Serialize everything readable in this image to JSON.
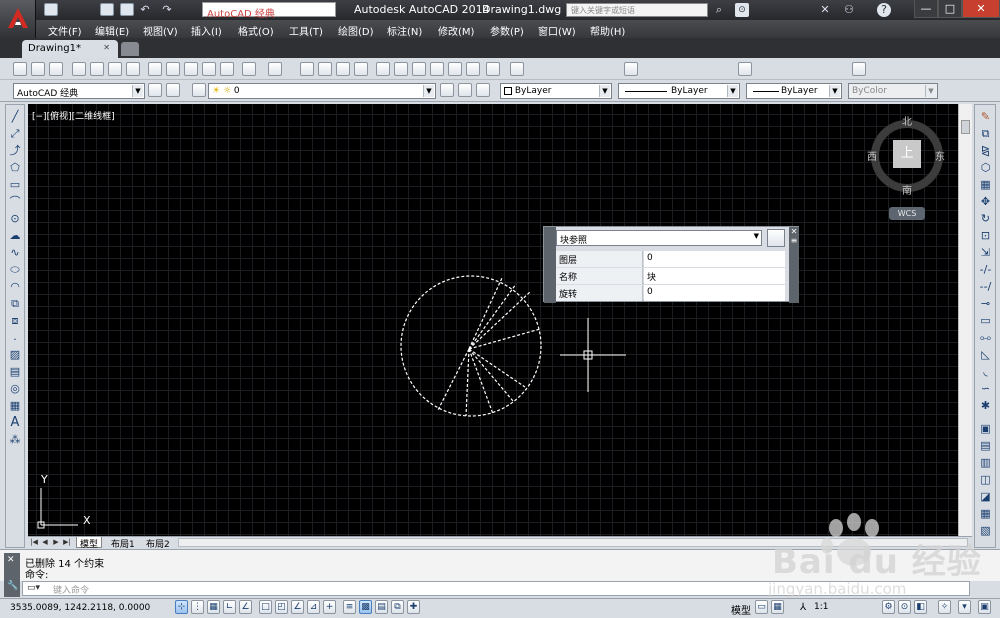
{
  "title": {
    "workspace": "AutoCAD 经典",
    "app_name": "Autodesk AutoCAD 2014",
    "file_name": "Drawing1.dwg",
    "search_placeholder": "键入关键字或短语",
    "window_controls": [
      "—",
      "□",
      "✕"
    ]
  },
  "menu": [
    "文件(F)",
    "编辑(E)",
    "视图(V)",
    "插入(I)",
    "格式(O)",
    "工具(T)",
    "绘图(D)",
    "标注(N)",
    "修改(M)",
    "参数(P)",
    "窗口(W)",
    "帮助(H)"
  ],
  "tabs": {
    "doc": "Drawing1*",
    "close": "✕"
  },
  "toolbar2": {
    "workspace": "AutoCAD 经典",
    "layer": "0",
    "color": "ByLayer",
    "linetype": "ByLayer",
    "lineweight": "ByLayer",
    "plotstyle": "ByColor"
  },
  "viewport_label": "[−][俯视][二维线框]",
  "viewcube": {
    "north": "北",
    "south": "南",
    "east": "东",
    "west": "西",
    "top": "上",
    "wcs": "WCS"
  },
  "properties": {
    "selection": "块参照",
    "rows": [
      {
        "key": "图层",
        "value": "0"
      },
      {
        "key": "名称",
        "value": "块"
      },
      {
        "key": "旋转",
        "value": "0"
      }
    ]
  },
  "ucs": {
    "x": "X",
    "y": "Y"
  },
  "layout_tabs": [
    "模型",
    "布局1",
    "布局2"
  ],
  "command": {
    "history1": "已删除  14  个约束",
    "history2": "命令:",
    "input_placeholder": "键入命令"
  },
  "status": {
    "coords": "3535.0089,  1242.2118,  0.0000",
    "model": "模型",
    "annotation_scale": "1:1"
  },
  "watermark": {
    "brand": "Bai du 经验",
    "url": "jingyan.baidu.com"
  },
  "colors": {
    "accent_red": "#c8201e",
    "canvas": "#000000",
    "grid": "#1c1d20",
    "chrome_dark": "#2e3034"
  },
  "icons": {
    "app": "autocad-logo-icon",
    "crosshair": "crosshair-cursor-icon"
  }
}
